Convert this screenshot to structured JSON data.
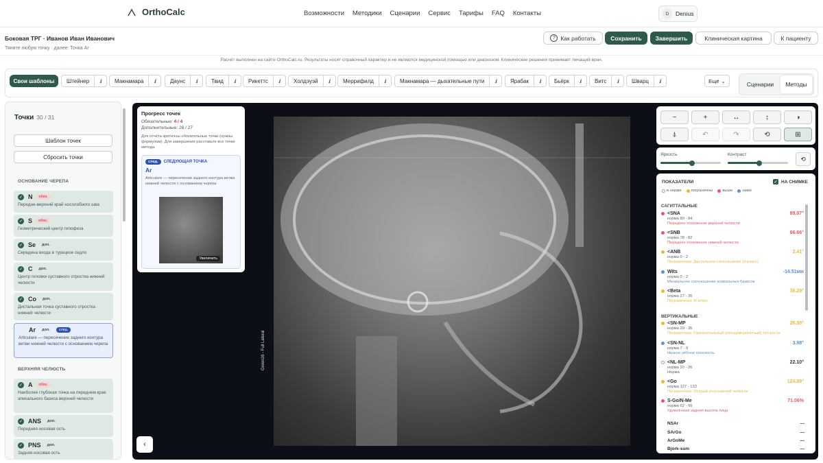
{
  "nav": {
    "brand": "OrthoCalc",
    "menu": [
      "Возможности",
      "Методики",
      "Сценарии",
      "Сервис",
      "Тарифы",
      "FAQ",
      "Контакты"
    ],
    "user_initials": "D",
    "user_name": "Denius"
  },
  "header": {
    "title": "Боковая ТРГ · Иванов Иван Иванович",
    "subtitle": "Тяните любую точку · далее: Точка Ar",
    "btn_how": "Как работать",
    "btn_save": "Сохранить",
    "btn_finish": "Завершить",
    "btn_clinical": "Клиническая картина",
    "btn_patient": "К пациенту"
  },
  "disclaimer": "Расчёт выполнен на сайте OrthoCalc.ru. Результаты носят справочный характер и не являются медицинской помощью или диагнозом. Клинические решения принимает лечащий врач.",
  "templates": {
    "own": "Свои шаблоны",
    "items": [
      "Штейнер",
      "Макнамара",
      "Даунс",
      "Твид",
      "Рикеттс",
      "Холдэуэй",
      "Меррифилд",
      "Макнамара — дыхательные пути",
      "Ярабак",
      "Бьёрк",
      "Витс",
      "Шварц"
    ],
    "info_glyph": "ℹ",
    "more": "Ещё",
    "mode_scen": "Сценарии",
    "mode_methods": "Методы"
  },
  "points_panel": {
    "title": "Точки",
    "count": "30 / 31",
    "btn_template": "Шаблон точек",
    "btn_reset": "Сбросить точки",
    "section_skull": "ОСНОВАНИЕ ЧЕРЕПА",
    "section_upper": "ВЕРХНЯЯ ЧЕЛЮСТЬ",
    "badge_ob": "обяз.",
    "badge_dop": "доп.",
    "badge_next": "след.",
    "points": [
      {
        "name": "N",
        "badge": "обяз.",
        "desc": "Передне-верхний край носолобного шва"
      },
      {
        "name": "S",
        "badge": "обяз.",
        "desc": "Геометрический центр гипофиза"
      },
      {
        "name": "Se",
        "badge": "доп.",
        "desc": "Середина входа в турецкое седло"
      },
      {
        "name": "C",
        "badge": "доп.",
        "desc": "Центр головки суставного отростка нижней челюсти"
      },
      {
        "name": "Co",
        "badge": "доп.",
        "desc": "Дистальная точка суставного отростка нижней челюсти"
      },
      {
        "name": "Ar",
        "badge": "доп.",
        "desc": "Articulare — пересечение заднего контура ветви нижней челюсти с основанием черепа"
      },
      {
        "name": "A",
        "badge": "обяз.",
        "desc": "Наиболее глубокая точка на переднем крае апикального базиса верхней челюсти"
      },
      {
        "name": "ANS",
        "badge": "доп.",
        "desc": "Передняя носовая ость"
      },
      {
        "name": "PNS",
        "badge": "доп.",
        "desc": "Задняя носовая ость"
      }
    ]
  },
  "progress": {
    "title": "Прогресс точек",
    "required_label": "Обязательные:",
    "required_value": "4 / 4",
    "extra_label": "Дополнительные:",
    "extra_value": "26 / 27",
    "note": "Для отчёта критичны обязательные точки (нужны формулам). Для завершения расставьте все точки метода.",
    "next_badge": "след.",
    "next_label": "СЛЕДУЮЩАЯ ТОЧКА",
    "next_name": "Ar",
    "next_desc": "Articulare — пересечение заднего контура ветви нижней челюсти с основанием черепа",
    "zoom": "Увеличить"
  },
  "viewer": {
    "image_label": "Green16 - Full Lateral"
  },
  "tools": {
    "row1": [
      "−",
      "+",
      "↔",
      "↕",
      "◑"
    ],
    "row2": [
      "⍋",
      "↶",
      "↷",
      "⟲",
      "⊞"
    ]
  },
  "adjust": {
    "brightness": "Яркость",
    "contrast": "Контраст",
    "brightness_level": 0.52,
    "contrast_level": 0.52
  },
  "metrics": {
    "title": "ПОКАЗАТЕЛИ",
    "on_image": "НА СНИМКЕ",
    "legend": [
      "в норме",
      "пограничны",
      "выше",
      "ниже"
    ],
    "colors": {
      "norm": "#c9cfd0",
      "border": "#e8b93a",
      "high": "#e05a6a",
      "low": "#5b8fd6"
    },
    "group_sag": "САГИТТАЛЬНЫЕ",
    "group_vert": "ВЕРТИКАЛЬНЫЕ",
    "rows": [
      {
        "name": "<SNA",
        "value": "89.07°",
        "norm": "норма 80 - 84",
        "ctx": "Переднее положение верхней челюсти",
        "status": "high"
      },
      {
        "name": "<SNB",
        "value": "86.66°",
        "norm": "норма 78 - 82",
        "ctx": "Переднее положение нижней челюсти",
        "status": "high"
      },
      {
        "name": "<ANB",
        "value": "2.41°",
        "norm": "норма 0 - 2",
        "ctx": "Пограничная: Дистальное соотношение (II класс)",
        "status": "border"
      },
      {
        "name": "Wits",
        "value": "-14.51мм",
        "norm": "норма 0 - 2",
        "ctx": "Мезиальное соотношение апикальных базисов",
        "status": "low"
      },
      {
        "name": "<Beta",
        "value": "36.29°",
        "norm": "норма 27 - 35",
        "ctx": "Пограничная: III класс",
        "status": "border"
      },
      {
        "name": "<SN-MP",
        "value": "26.08°",
        "norm": "норма 29 - 35",
        "ctx": "Пограничная: Горизонтальный (гиподивергентный) тип роста",
        "status": "border"
      },
      {
        "name": "<SN-NL",
        "value": "3.98°",
        "norm": "норма 7 - 9",
        "ctx": "Низкое нёбное плоскость",
        "status": "low"
      },
      {
        "name": "<NL-MP",
        "value": "22.10°",
        "norm": "норма 20 - 26",
        "ctx": "Норма",
        "status": "norm"
      },
      {
        "name": "<Go",
        "value": "124.09°",
        "norm": "норма 127 - 133",
        "ctx": "Пограничная: Острый угол нижней челюсти",
        "status": "border"
      },
      {
        "name": "S-Go/N-Me",
        "value": "71.06%",
        "norm": "норма 62 - 66",
        "ctx": "Удлинённая задняя высота лица",
        "status": "high"
      }
    ],
    "plain": [
      {
        "name": "NSAr",
        "value": "—"
      },
      {
        "name": "SArGo",
        "value": "—"
      },
      {
        "name": "ArGoMe",
        "value": "—"
      },
      {
        "name": "Bjork-sum",
        "value": "—"
      }
    ]
  }
}
